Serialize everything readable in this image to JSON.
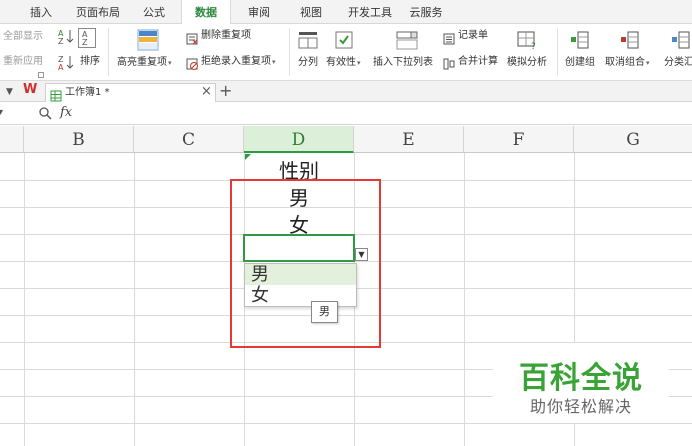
{
  "ribbon": {
    "tabs": [
      "插入",
      "页面布局",
      "公式",
      "数据",
      "审阅",
      "视图",
      "开发工具",
      "云服务"
    ],
    "active_tab": "数据",
    "outline": {
      "show_all": "全部显示",
      "reapply": "重新应用"
    },
    "sort": {
      "label": "排序"
    },
    "highlight_duplicates": "高亮重复项",
    "remove_duplicates": "删除重复项",
    "reject_duplicates": "拒绝录入重复项",
    "split_column": "分列",
    "validation": "有效性",
    "insert_dropdown": "插入下拉列表",
    "record_form": "记录单",
    "consolidate": "合并计算",
    "what_if": "模拟分析",
    "group": "创建组",
    "ungroup": "取消组合",
    "subtotal": "分类汇"
  },
  "document": {
    "tab_title": "工作簿1 *"
  },
  "formula_bar": {
    "fx": "fx",
    "value": ""
  },
  "sheet": {
    "columns": [
      "B",
      "C",
      "D",
      "E",
      "F",
      "G"
    ],
    "selected_column": "D",
    "cells": {
      "D1": "性别",
      "D2": "男",
      "D3": "女",
      "D4": ""
    },
    "dropdown_options": [
      "男",
      "女"
    ],
    "tooltip": "男"
  },
  "watermark": {
    "title": "百科全说",
    "subtitle": "助你轻松解决"
  },
  "colors": {
    "accent_green": "#2e9b44",
    "highlight_red": "#e53935",
    "watermark_green": "#3aa335",
    "selected_header": "#dcefd9"
  }
}
